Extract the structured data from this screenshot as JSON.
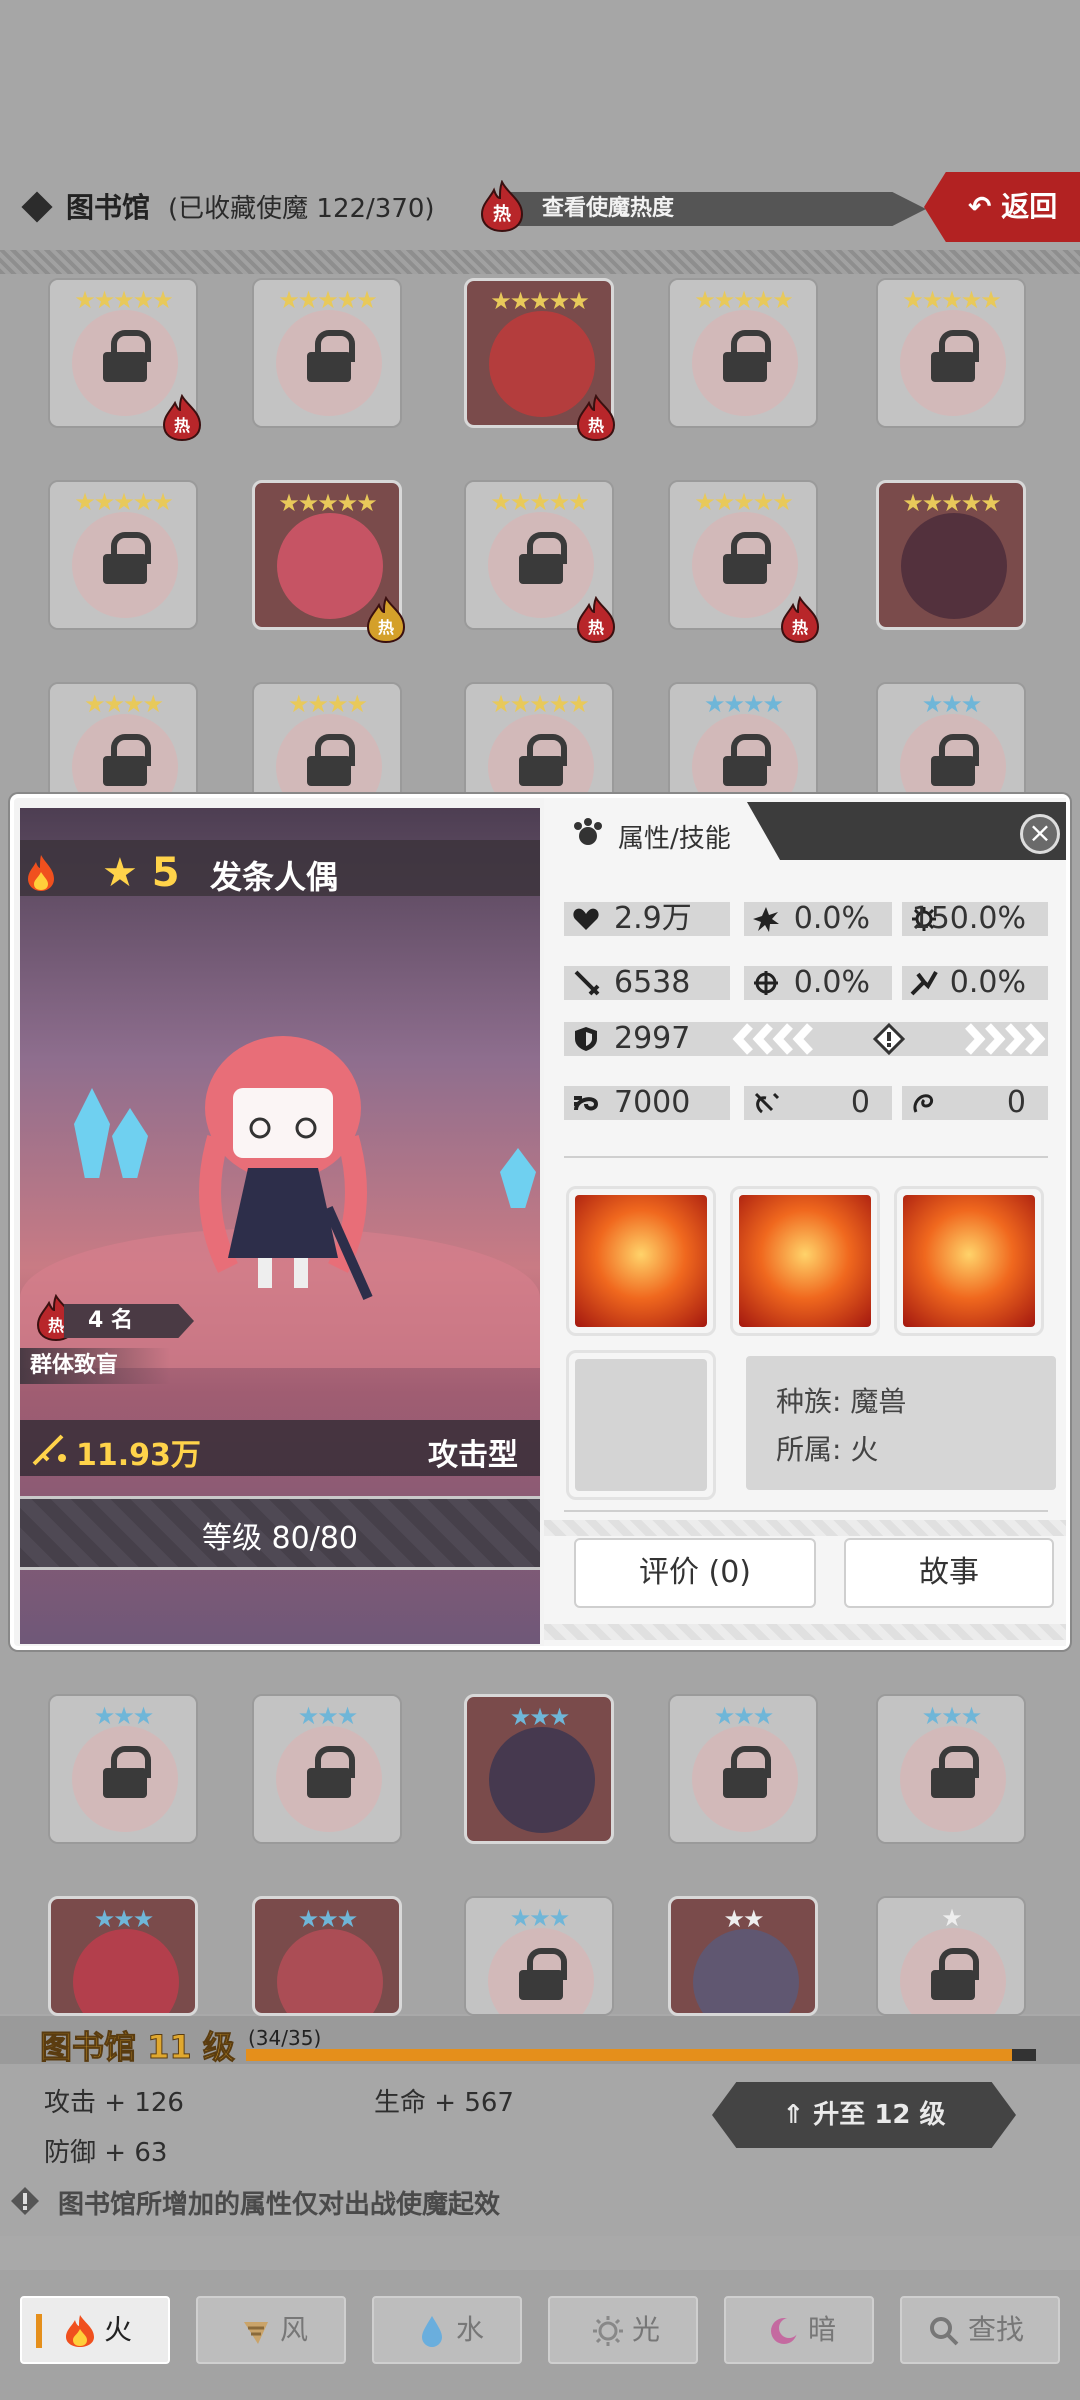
{
  "header": {
    "title": "图书馆",
    "collected": "(已收藏使魔 122/370)",
    "heat_badge": "热",
    "heat_button": "查看使魔热度",
    "back_button": "返回"
  },
  "hot_badge_text": "热",
  "modal": {
    "star_level": "5",
    "name": "发条人偶",
    "hot_rank": "4 名",
    "hot_rank_badge": "热",
    "skill_tag": "群体致盲",
    "power": "11.93万",
    "type": "攻击型",
    "level": "等级 80/80",
    "tab_label": "属性/技能",
    "close": "×",
    "stats": {
      "hp": "2.9万",
      "crit": "0.0%",
      "crit_dmg": "150.0%",
      "attack": "6538",
      "hit": "0.0%",
      "dodge": "0.0%",
      "defense": "2997",
      "speed": "7000",
      "res1": "0",
      "res2": "0"
    },
    "race_line": "种族:  魔兽",
    "belong_line": "所属:  火",
    "review_button": "评价 (0)",
    "story_button": "故事"
  },
  "library": {
    "title": "图书馆 11 级",
    "progress_text": "(34/35)",
    "progress": 0.97,
    "attack": "攻击 + 126",
    "hp": "生命 + 567",
    "defense": "防御 + 63",
    "upgrade": "升至 12 级",
    "notice": "图书馆所增加的属性仅对出战使魔起效"
  },
  "element_tabs": [
    {
      "label": "火",
      "icon": "flame-icon",
      "active": true
    },
    {
      "label": "风",
      "icon": "wind-icon",
      "active": false
    },
    {
      "label": "水",
      "icon": "water-drop-icon",
      "active": false
    },
    {
      "label": "光",
      "icon": "sun-icon",
      "active": false
    },
    {
      "label": "暗",
      "icon": "moon-icon",
      "active": false
    },
    {
      "label": "查找",
      "icon": "search-icon",
      "active": false
    }
  ],
  "colors": {
    "accent": "#e58f1b",
    "hot": "#b22222",
    "gold": "#ffd34a"
  }
}
